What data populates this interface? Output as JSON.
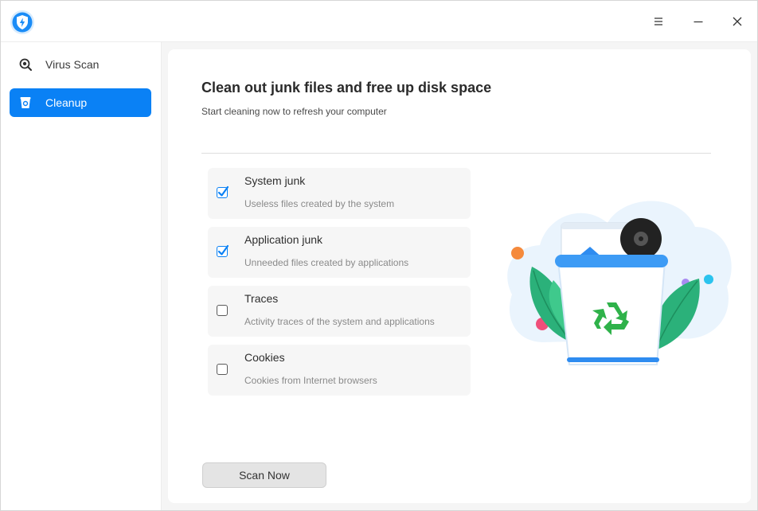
{
  "sidebar": {
    "items": [
      {
        "label": "Virus Scan",
        "icon": "virus-scan-icon",
        "active": false
      },
      {
        "label": "Cleanup",
        "icon": "cleanup-icon",
        "active": true
      }
    ]
  },
  "main": {
    "title": "Clean out junk files and free up disk space",
    "subtitle": "Start cleaning now to refresh your computer",
    "options": [
      {
        "label": "System junk",
        "description": "Useless files created by the system",
        "checked": true
      },
      {
        "label": "Application junk",
        "description": "Unneeded files created by applications",
        "checked": true
      },
      {
        "label": "Traces",
        "description": "Activity traces of the system and applications",
        "checked": false
      },
      {
        "label": "Cookies",
        "description": "Cookies from Internet browsers",
        "checked": false
      }
    ],
    "scan_button": "Scan Now"
  },
  "colors": {
    "accent": "#0a81f5",
    "recycle_green": "#2fb24a"
  }
}
